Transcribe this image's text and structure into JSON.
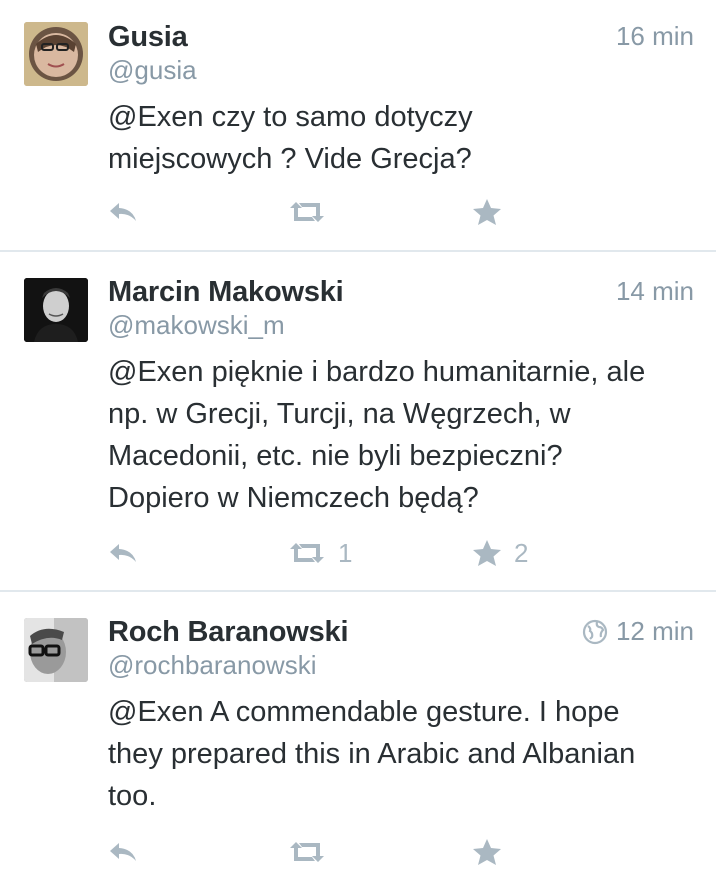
{
  "tweets": [
    {
      "name": "Gusia",
      "handle": "@gusia",
      "time": "16 min",
      "text_lines": [
        "@Exen czy to samo dotyczy",
        "miejscowych ? Vide Grecja?"
      ],
      "retweets": "",
      "favorites": "",
      "globe": false
    },
    {
      "name": "Marcin Makowski",
      "handle": "@makowski_m",
      "time": "14 min",
      "text_lines": [
        "@Exen pięknie i bardzo humanitarnie, ale",
        "np. w Grecji, Turcji, na Węgrzech, w",
        "Macedonii, etc. nie byli bezpieczni?",
        "Dopiero w Niemczech będą?"
      ],
      "retweets": "1",
      "favorites": "2",
      "globe": false
    },
    {
      "name": "Roch Baranowski",
      "handle": "@rochbaranowski",
      "time": "12 min",
      "text_lines": [
        "@Exen A commendable gesture. I hope",
        "they prepared this in Arabic and Albanian",
        "too."
      ],
      "retweets": "",
      "favorites": "",
      "globe": true
    }
  ],
  "colors": {
    "text": "#292f33",
    "muted": "#8899a6",
    "icon": "#aab8c2",
    "divider": "#e1e8ed"
  },
  "icons": {
    "reply": "reply-icon",
    "retweet": "retweet-icon",
    "favorite": "star-icon",
    "globe": "globe-icon"
  }
}
